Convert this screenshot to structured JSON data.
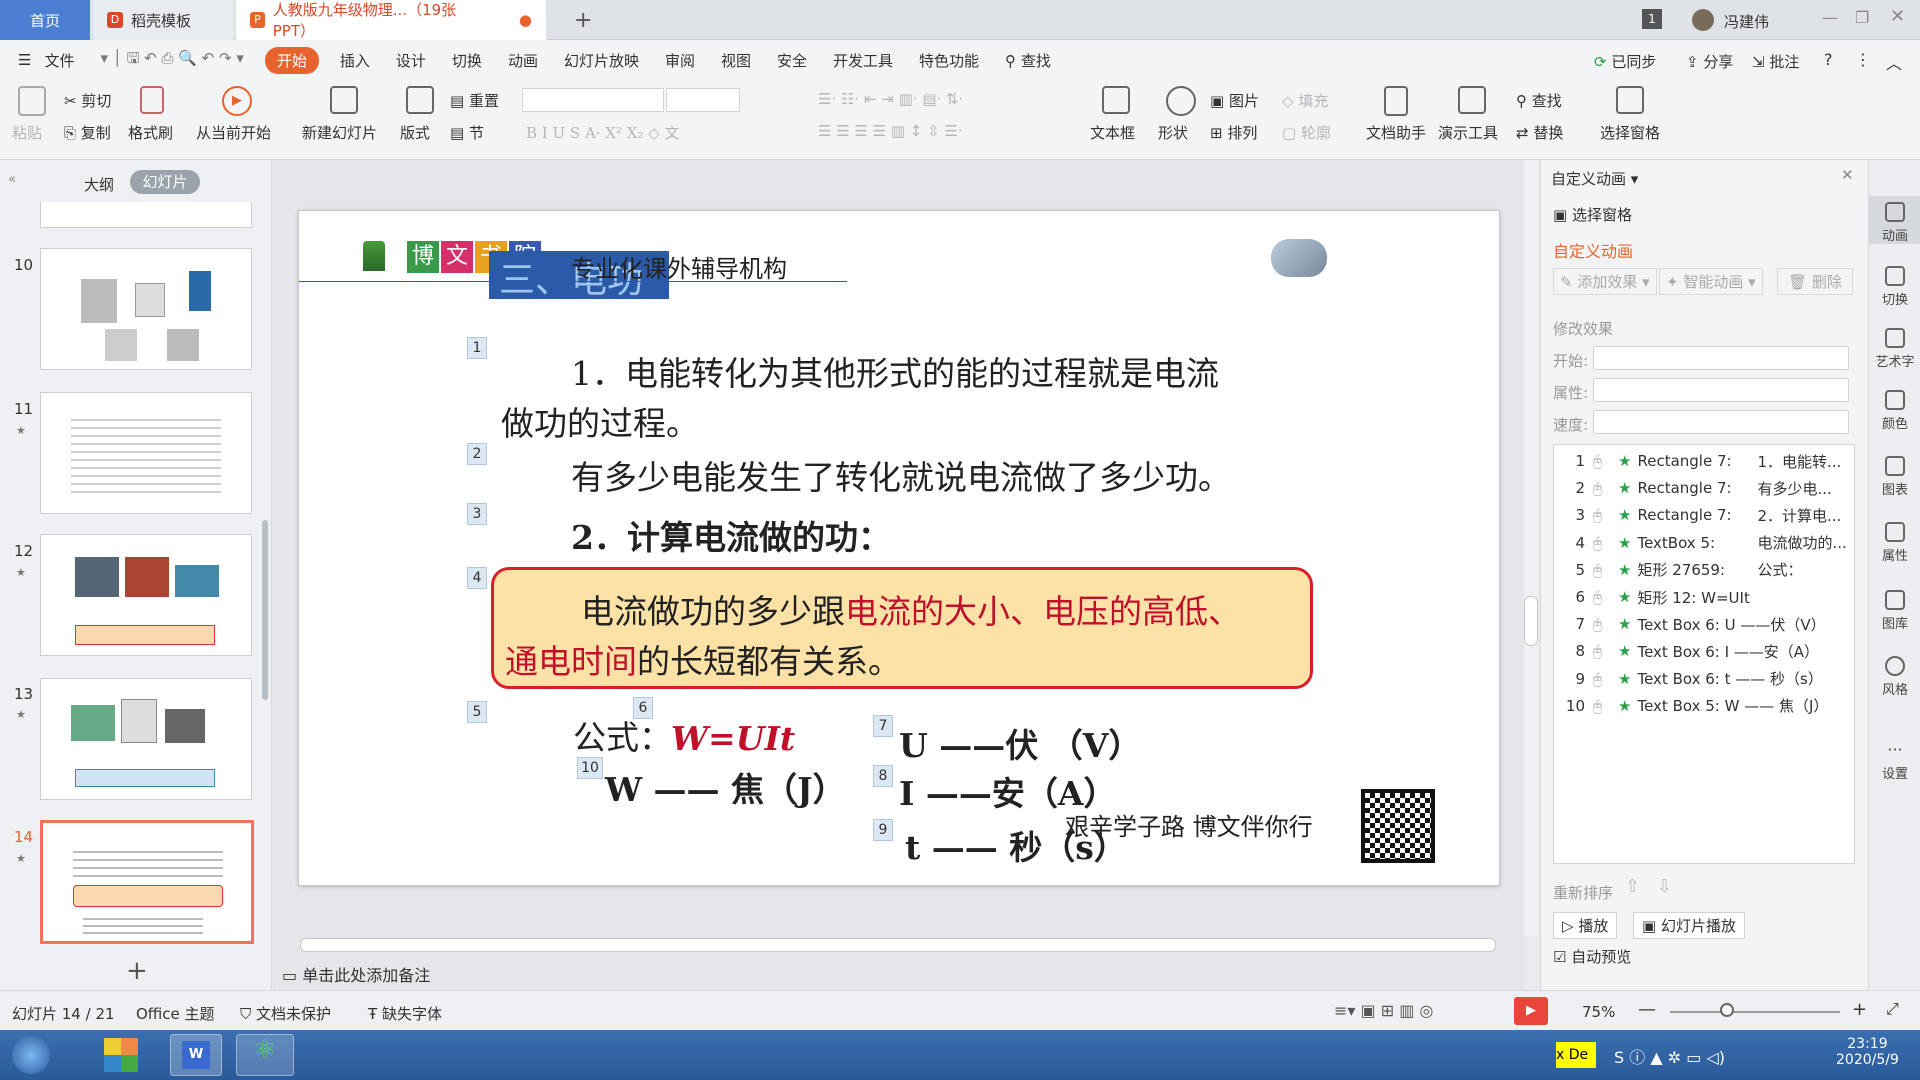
{
  "tabs": {
    "home": "首页",
    "daoke": "稻壳模板",
    "doc": "人教版九年级物理...（19张PPT）",
    "new_tab": "+",
    "count_badge": "1",
    "user": "冯建伟"
  },
  "menu": {
    "file": "文件",
    "items": [
      "开始",
      "插入",
      "设计",
      "切换",
      "动画",
      "幻灯片放映",
      "审阅",
      "视图",
      "安全",
      "开发工具",
      "特色功能"
    ],
    "search": "查找",
    "synced": "已同步",
    "share": "分享",
    "annotate": "批注"
  },
  "ribbon": {
    "paste": "粘贴",
    "cut": "剪切",
    "copy": "复制",
    "format_painter": "格式刷",
    "play_from_current": "从当前开始",
    "new_slide": "新建幻灯片",
    "layout": "版式",
    "reset": "重置",
    "section": "节",
    "text_box": "文本框",
    "shape": "形状",
    "picture": "图片",
    "arrange": "排列",
    "fill": "填充",
    "outline": "轮廓",
    "doc_assistant": "文档助手",
    "present_tools": "演示工具",
    "find": "查找",
    "replace": "替换",
    "select_pane": "选择窗格"
  },
  "left": {
    "tab_outline": "大纲",
    "tab_slides": "幻灯片",
    "slide_numbers": [
      "10",
      "11",
      "12",
      "13",
      "14"
    ],
    "add": "+"
  },
  "slide": {
    "org": "专业化课外辅导机构",
    "logo_chars": [
      "博",
      "文",
      "书",
      "院"
    ],
    "heading": "三、电功",
    "p1a": "1．电能转化为其他形式的能的过程就是电流",
    "p1b": "做功的过程。",
    "p2": "有多少电能发生了转化就说电流做了多少功。",
    "p3": "2．计算电流做的功：",
    "box_a": "电流做功的多少跟",
    "box_a_red": "电流的大小、电压的高低、",
    "box_b_red": "通电时间",
    "box_b": "的长短都有关系。",
    "formula_label": "公式：",
    "formula": "W=UIt",
    "u_line": "U ——伏 （V）",
    "i_line": "I ——安（A）",
    "t_line": "t  —— 秒（s）",
    "w_line": "W —— 焦（J）",
    "slogan": "艰辛学子路  博文伴你行",
    "tags": [
      "1",
      "2",
      "3",
      "4",
      "5",
      "6",
      "7",
      "8",
      "9",
      "10"
    ]
  },
  "notes": "单击此处添加备注",
  "right": {
    "title": "自定义动画",
    "select_pane": "选择窗格",
    "section": "自定义动画",
    "add_effect": "添加效果",
    "smart_anim": "智能动画",
    "delete": "删除",
    "modify": "修改效果",
    "start": "开始:",
    "property": "属性:",
    "speed": "速度:",
    "reorder": "重新排序",
    "play": "播放",
    "slideshow": "幻灯片播放",
    "auto_preview": "自动预览",
    "animations": [
      {
        "n": "1",
        "name": "Rectangle 7:",
        "text": "1．电能转..."
      },
      {
        "n": "2",
        "name": "Rectangle 7:",
        "text": "有多少电..."
      },
      {
        "n": "3",
        "name": "Rectangle 7:",
        "text": "2．计算电..."
      },
      {
        "n": "4",
        "name": "TextBox 5:",
        "text": "电流做功的..."
      },
      {
        "n": "5",
        "name": "矩形 27659:",
        "text": "公式："
      },
      {
        "n": "6",
        "name": "矩形 12: W=UIt",
        "text": ""
      },
      {
        "n": "7",
        "name": "Text Box 6: U ——伏（V）",
        "text": ""
      },
      {
        "n": "8",
        "name": "Text Box 6: I ——安（A）",
        "text": ""
      },
      {
        "n": "9",
        "name": "Text Box 6: t  —— 秒（s）",
        "text": ""
      },
      {
        "n": "10",
        "name": "Text Box 5: W —— 焦（J）",
        "text": ""
      }
    ]
  },
  "sidebar": [
    "动画",
    "切换",
    "艺术字",
    "颜色",
    "图表",
    "属性",
    "图库",
    "风格",
    "设置"
  ],
  "status": {
    "slide": "幻灯片 14 / 21",
    "theme": "Office 主题",
    "protect": "文档未保护",
    "font": "缺失字体",
    "zoom": "75%"
  },
  "taskbar": {
    "time": "23:19",
    "date": "2020/5/9",
    "de": "x De"
  }
}
